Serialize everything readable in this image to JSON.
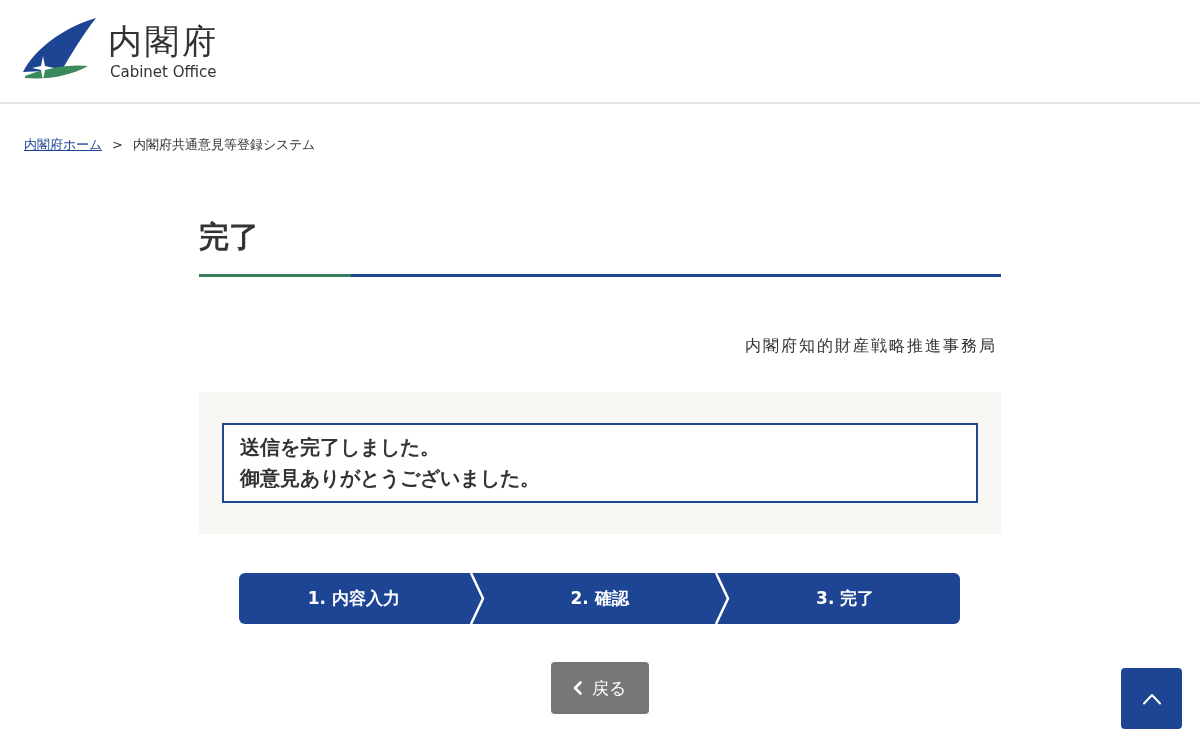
{
  "header": {
    "logo_title": "内閣府",
    "logo_subtitle": "Cabinet Office"
  },
  "breadcrumb": {
    "separator": ">",
    "items": [
      {
        "label": "内閣府ホーム",
        "kind": "link"
      },
      {
        "label": "内閣府共通意見等登録システム",
        "kind": "current"
      }
    ]
  },
  "page_title": "完了",
  "department": "内閣府知的財産戦略推進事務局",
  "message": {
    "lines": [
      "送信を完了しました。",
      "御意見ありがとうございました。"
    ]
  },
  "steps": [
    {
      "label": "1. 内容入力"
    },
    {
      "label": "2. 確認"
    },
    {
      "label": "3. 完了"
    }
  ],
  "back_button": {
    "label": "戻る"
  }
}
